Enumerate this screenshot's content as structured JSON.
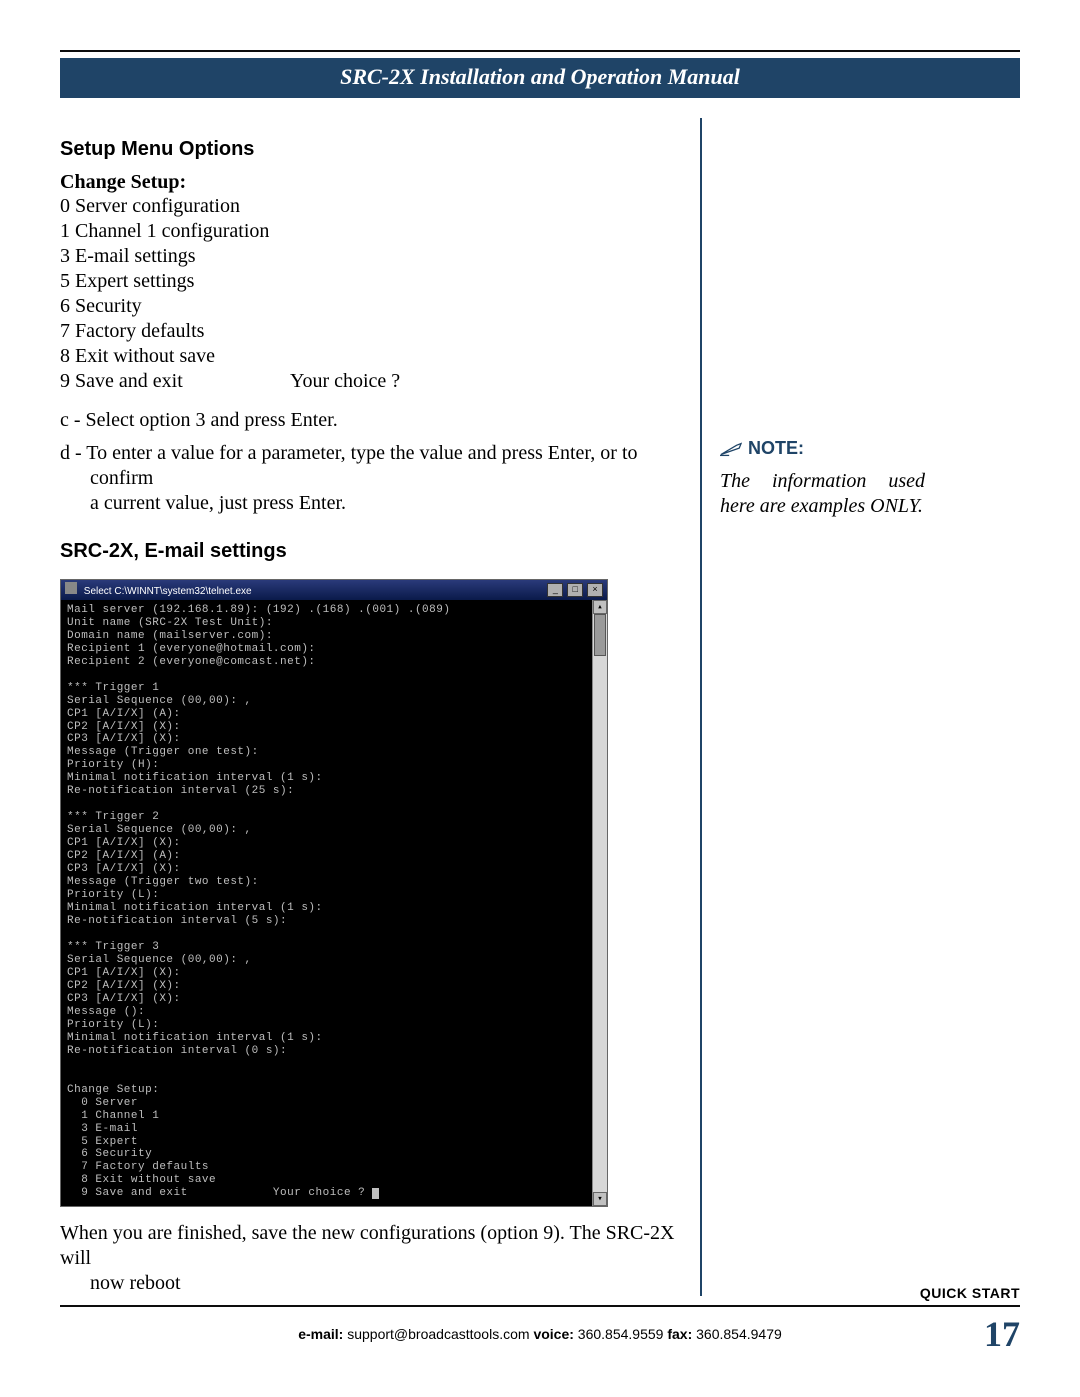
{
  "header": {
    "title": "SRC-2X Installation and Operation Manual"
  },
  "section": {
    "heading": "Setup Menu Options"
  },
  "change_setup": {
    "label": "Change Setup:",
    "items": [
      "0 Server configuration",
      "1 Channel 1 configuration",
      "3 E-mail settings",
      "5 Expert settings",
      "6 Security",
      "7 Factory defaults",
      "8 Exit without save"
    ],
    "last_left": "9 Save and exit",
    "last_right": "Your choice ?"
  },
  "instructions": {
    "c": "c - Select option 3 and press Enter.",
    "d1": "d - To enter a value for a parameter, type the value and press Enter, or to confirm",
    "d2": "a current value, just press Enter."
  },
  "email_heading": "SRC-2X, E-mail settings",
  "terminal": {
    "title": "Select C:\\WINNT\\system32\\telnet.exe",
    "body": "Mail server (192.168.1.89): (192) .(168) .(001) .(089)\nUnit name (SRC-2X Test Unit):\nDomain name (mailserver.com):\nRecipient 1 (everyone@hotmail.com):\nRecipient 2 (everyone@comcast.net):\n\n*** Trigger 1\nSerial Sequence (00,00): ,\nCP1 [A/I/X] (A):\nCP2 [A/I/X] (X):\nCP3 [A/I/X] (X):\nMessage (Trigger one test):\nPriority (H):\nMinimal notification interval (1 s):\nRe-notification interval (25 s):\n\n*** Trigger 2\nSerial Sequence (00,00): ,\nCP1 [A/I/X] (X):\nCP2 [A/I/X] (A):\nCP3 [A/I/X] (X):\nMessage (Trigger two test):\nPriority (L):\nMinimal notification interval (1 s):\nRe-notification interval (5 s):\n\n*** Trigger 3\nSerial Sequence (00,00): ,\nCP1 [A/I/X] (X):\nCP2 [A/I/X] (X):\nCP3 [A/I/X] (X):\nMessage ():\nPriority (L):\nMinimal notification interval (1 s):\nRe-notification interval (0 s):\n\n\nChange Setup:\n  0 Server\n  1 Channel 1\n  3 E-mail\n  5 Expert\n  6 Security\n  7 Factory defaults\n  8 Exit without save\n  9 Save and exit            Your choice ? "
  },
  "after": {
    "line1": "When you are finished, save the new configurations (option 9). The SRC-2X will",
    "line2": "now reboot"
  },
  "sidebar": {
    "note_label": "NOTE:",
    "note_body": "The information used here are examples ONLY."
  },
  "footer": {
    "quick_start": "QUICK START",
    "email_label": "e-mail:",
    "email_value": " support@broadcasttools.com   ",
    "voice_label": "voice:",
    "voice_value": " 360.854.9559   ",
    "fax_label": "fax:",
    "fax_value": " 360.854.9479",
    "page_num": "17"
  }
}
